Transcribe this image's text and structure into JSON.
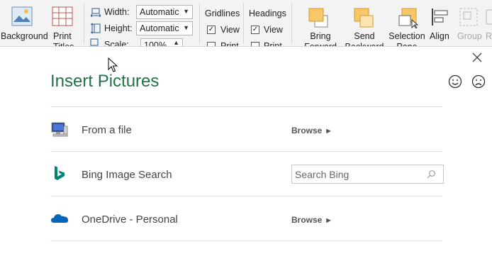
{
  "ribbon": {
    "background_label": "Background",
    "print_titles_label": "Print Titles",
    "width_label": "Width:",
    "height_label": "Height:",
    "scale_label": "Scale:",
    "width_value": "Automatic",
    "height_value": "Automatic",
    "scale_value": "100%",
    "gridlines_label": "Gridlines",
    "gridlines_view": "View",
    "gridlines_print": "Print",
    "headings_label": "Headings",
    "headings_view": "View",
    "headings_print": "Print",
    "bring_forward_label": "Bring Forward",
    "send_backward_label": "Send Backward",
    "selection_pane_label": "Selection Pane",
    "align_label": "Align",
    "group_label": "Group",
    "rotate_label": "Ro"
  },
  "dialog": {
    "title": "Insert Pictures",
    "rows": [
      {
        "label": "From a file",
        "action": "Browse",
        "icon": "computer-icon"
      },
      {
        "label": "Bing Image Search",
        "search_placeholder": "Search Bing",
        "icon": "bing-icon"
      },
      {
        "label": "OneDrive - Personal",
        "action": "Browse",
        "icon": "onedrive-icon"
      }
    ]
  },
  "colors": {
    "title_green": "#217346",
    "bing_teal": "#008373",
    "onedrive_blue": "#0364b8"
  }
}
